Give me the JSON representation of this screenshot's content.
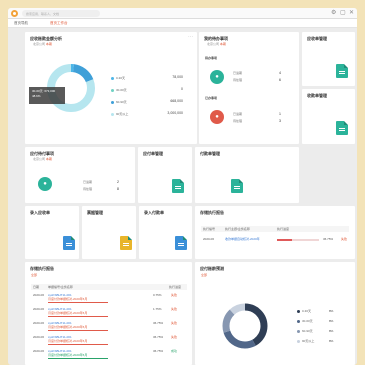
{
  "app": {
    "search_placeholder": "搜索应用、联系人、文档",
    "tabs": [
      "首页导航",
      "首页工作台"
    ],
    "window_controls": [
      "⚙",
      "▢",
      "✕"
    ]
  },
  "asset_card": {
    "title": "应收账款金额分析",
    "sub_prefix": "北京公司",
    "sub_tag": "本期",
    "tooltip_line1": "30-60天: 673,000",
    "tooltip_line2": "48.6%",
    "legend": [
      {
        "label": "0-30天",
        "value": "78,000",
        "color": "#4db6e8"
      },
      {
        "label": "30-60天",
        "value": "0",
        "color": "#6fd1c3"
      },
      {
        "label": "60-90天",
        "value": "668,000",
        "color": "#3fa0d8"
      },
      {
        "label": "90天以上",
        "value": "3,000,000",
        "color": "#b6e6ef"
      }
    ],
    "donut_fractions": [
      0.02,
      0.0,
      0.17,
      0.81
    ]
  },
  "pending_card": {
    "title": "我的待办事项",
    "sub_prefix": "北京公司",
    "sub_tag": "本期",
    "section1": "待办事项",
    "section2": "已办事项",
    "rows1": [
      {
        "label": "已逾期",
        "num": "4"
      },
      {
        "label": "待处理",
        "num": "6"
      }
    ],
    "rows2": [
      {
        "label": "已逾期",
        "num": "1"
      },
      {
        "label": "待处理",
        "num": "3"
      }
    ]
  },
  "quick_cards": [
    {
      "title": "应收单管理"
    },
    {
      "title": "收款单管理"
    }
  ],
  "todo_card": {
    "title": "应付待付事项",
    "sub_prefix": "北京公司",
    "sub_tag": "本期",
    "rows": [
      {
        "label": "已逾期",
        "num": "2"
      },
      {
        "label": "待处理",
        "num": "8"
      }
    ]
  },
  "mid_cards": [
    {
      "title": "应付单管理"
    },
    {
      "title": "付款单管理"
    }
  ],
  "bottom_quick": [
    {
      "title": "录入应收单"
    },
    {
      "title": "票据管理"
    },
    {
      "title": "录入付款单"
    }
  ],
  "exec_card": {
    "title": "存储执行报告",
    "headers": [
      "执行编号",
      "执行主题/业务名称",
      "执行进度"
    ],
    "row": {
      "no": "2020-06",
      "name": "收款单据自动核对-2020年",
      "percent": "36.75%",
      "status": "失败"
    },
    "progress": 0.3675
  },
  "report_card": {
    "title": "存储执行报告",
    "sub_tag": "全部",
    "headers": [
      "日期",
      "单据编号/业务名称",
      "执行进度"
    ],
    "rows": [
      {
        "date": "2020-06",
        "code": "sysKSBHT11-001",
        "name": "月度付款单据核对-2020年5月",
        "percent": "0.75%",
        "status": "失败",
        "color": "red"
      },
      {
        "date": "2020-06",
        "code": "sysKSBHT11-001",
        "name": "月度付款单据核对-2020年5月",
        "percent": "1.75%",
        "status": "失败",
        "color": "red"
      },
      {
        "date": "2020-06",
        "code": "sysKSBHT11-001",
        "name": "月度付款单据核对-2020年5月",
        "percent": "36.75%",
        "status": "失败",
        "color": "red"
      },
      {
        "date": "2020-06",
        "code": "sysKSBHT11-001",
        "name": "月度付款单据核对-2020年5月",
        "percent": "36.75%",
        "status": "失败",
        "color": "red"
      },
      {
        "date": "2020-06",
        "code": "sysKSBHT11-001",
        "name": "月度付款单据核对-2020年5月",
        "percent": "36.75%",
        "status": "成功",
        "color": "green"
      }
    ]
  },
  "split_card": {
    "title": "应付账龄预测",
    "sub_tag": "全部",
    "legend": [
      {
        "label": "0-30天",
        "value": "8%",
        "color": "#2f3e55"
      },
      {
        "label": "30-60天",
        "value": "8%",
        "color": "#516789"
      },
      {
        "label": "60-90天",
        "value": "8%",
        "color": "#8797b1"
      },
      {
        "label": "90天以上",
        "value": "8%",
        "color": "#c9d2df"
      }
    ],
    "donut_fractions": [
      0.42,
      0.28,
      0.18,
      0.12
    ]
  }
}
